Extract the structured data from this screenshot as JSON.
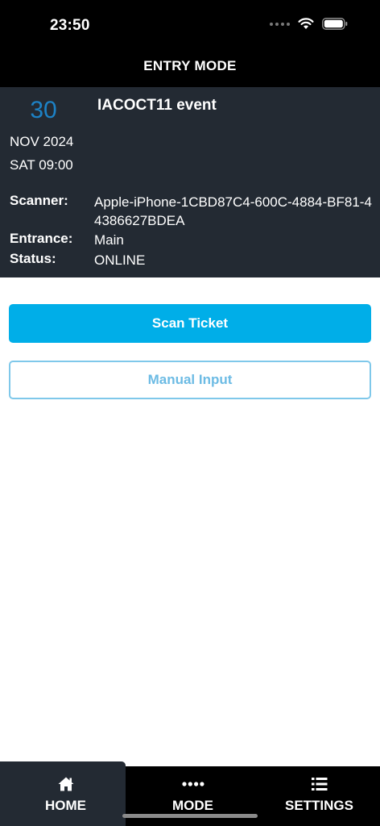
{
  "status_bar": {
    "time": "23:50"
  },
  "header": {
    "title": "ENTRY MODE"
  },
  "event": {
    "day": "30",
    "month_year": "NOV 2024",
    "weekday_time": "SAT 09:00",
    "title": "IACOCT11 event"
  },
  "details": {
    "scanner_label": "Scanner:",
    "scanner_value": "Apple-iPhone-1CBD87C4-600C-4884-BF81-44386627BDEA",
    "entrance_label": "Entrance:",
    "entrance_value": "Main",
    "status_label": "Status:",
    "status_value": "ONLINE"
  },
  "actions": {
    "scan_label": "Scan Ticket",
    "manual_label": "Manual Input"
  },
  "tabs": [
    {
      "label": "HOME",
      "icon": "home-icon"
    },
    {
      "label": "MODE",
      "icon": "dots-icon"
    },
    {
      "label": "SETTINGS",
      "icon": "list-icon"
    }
  ],
  "colors": {
    "accent": "#00aee8",
    "panel": "#232a33",
    "date_blue": "#1d82c6",
    "outline": "#7fc8ea"
  }
}
